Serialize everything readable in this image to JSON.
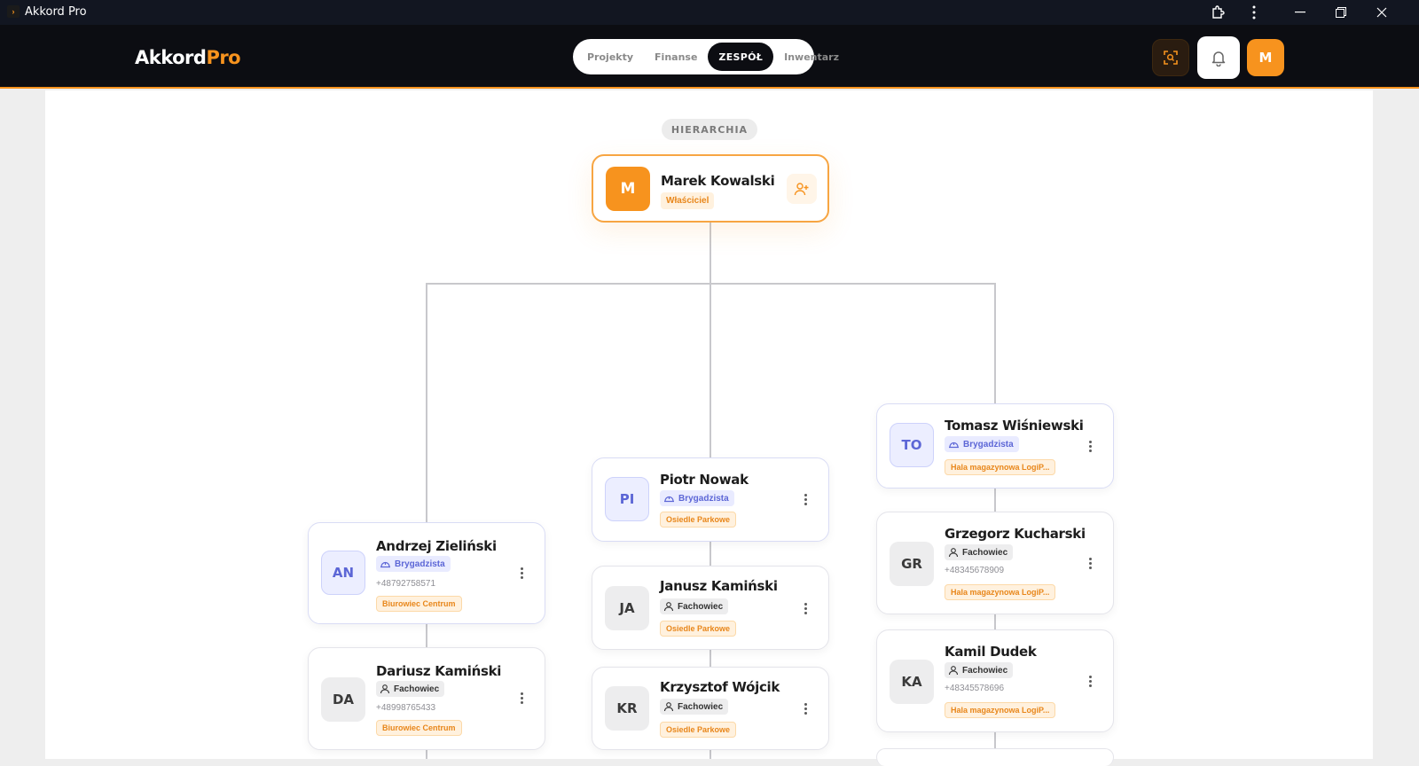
{
  "window": {
    "title": "Akkord Pro"
  },
  "header": {
    "logo_main": "Akkord",
    "logo_accent": "Pro",
    "tabs": [
      {
        "label": "Projekty",
        "active": false
      },
      {
        "label": "Finanse",
        "active": false
      },
      {
        "label": "ZESPÓŁ",
        "active": true
      },
      {
        "label": "Inwentarz",
        "active": false
      }
    ],
    "avatar_initial": "M"
  },
  "section_label": "HIERARCHIA",
  "owner": {
    "initials": "M",
    "name": "Marek Kowalski",
    "role": "Właściciel"
  },
  "team": {
    "andrzej": {
      "initials": "AN",
      "name": "Andrzej Zieliński",
      "role": "Brygadzista",
      "phone": "+48792758571",
      "site": "Biurowiec Centrum"
    },
    "dariusz": {
      "initials": "DA",
      "name": "Dariusz Kamiński",
      "role": "Fachowiec",
      "phone": "+48998765433",
      "site": "Biurowiec Centrum"
    },
    "piotr": {
      "initials": "PI",
      "name": "Piotr Nowak",
      "role": "Brygadzista",
      "site": "Osiedle Parkowe"
    },
    "janusz": {
      "initials": "JA",
      "name": "Janusz Kamiński",
      "role": "Fachowiec",
      "site": "Osiedle Parkowe"
    },
    "krzysztof": {
      "initials": "KR",
      "name": "Krzysztof Wójcik",
      "role": "Fachowiec",
      "site": "Osiedle Parkowe"
    },
    "tomasz": {
      "initials": "TO",
      "name": "Tomasz Wiśniewski",
      "role": "Brygadzista",
      "site": "Hala magazynowa LogiP..."
    },
    "grzegorz": {
      "initials": "GR",
      "name": "Grzegorz Kucharski",
      "role": "Fachowiec",
      "phone": "+48345678909",
      "site": "Hala magazynowa LogiP..."
    },
    "kamil": {
      "initials": "KA",
      "name": "Kamil Dudek",
      "role": "Fachowiec",
      "phone": "+48345578696",
      "site": "Hala magazynowa LogiP..."
    }
  },
  "colors": {
    "accent": "#f7931e",
    "lead": "#5c66d6",
    "header_bg": "#0c0d12"
  }
}
